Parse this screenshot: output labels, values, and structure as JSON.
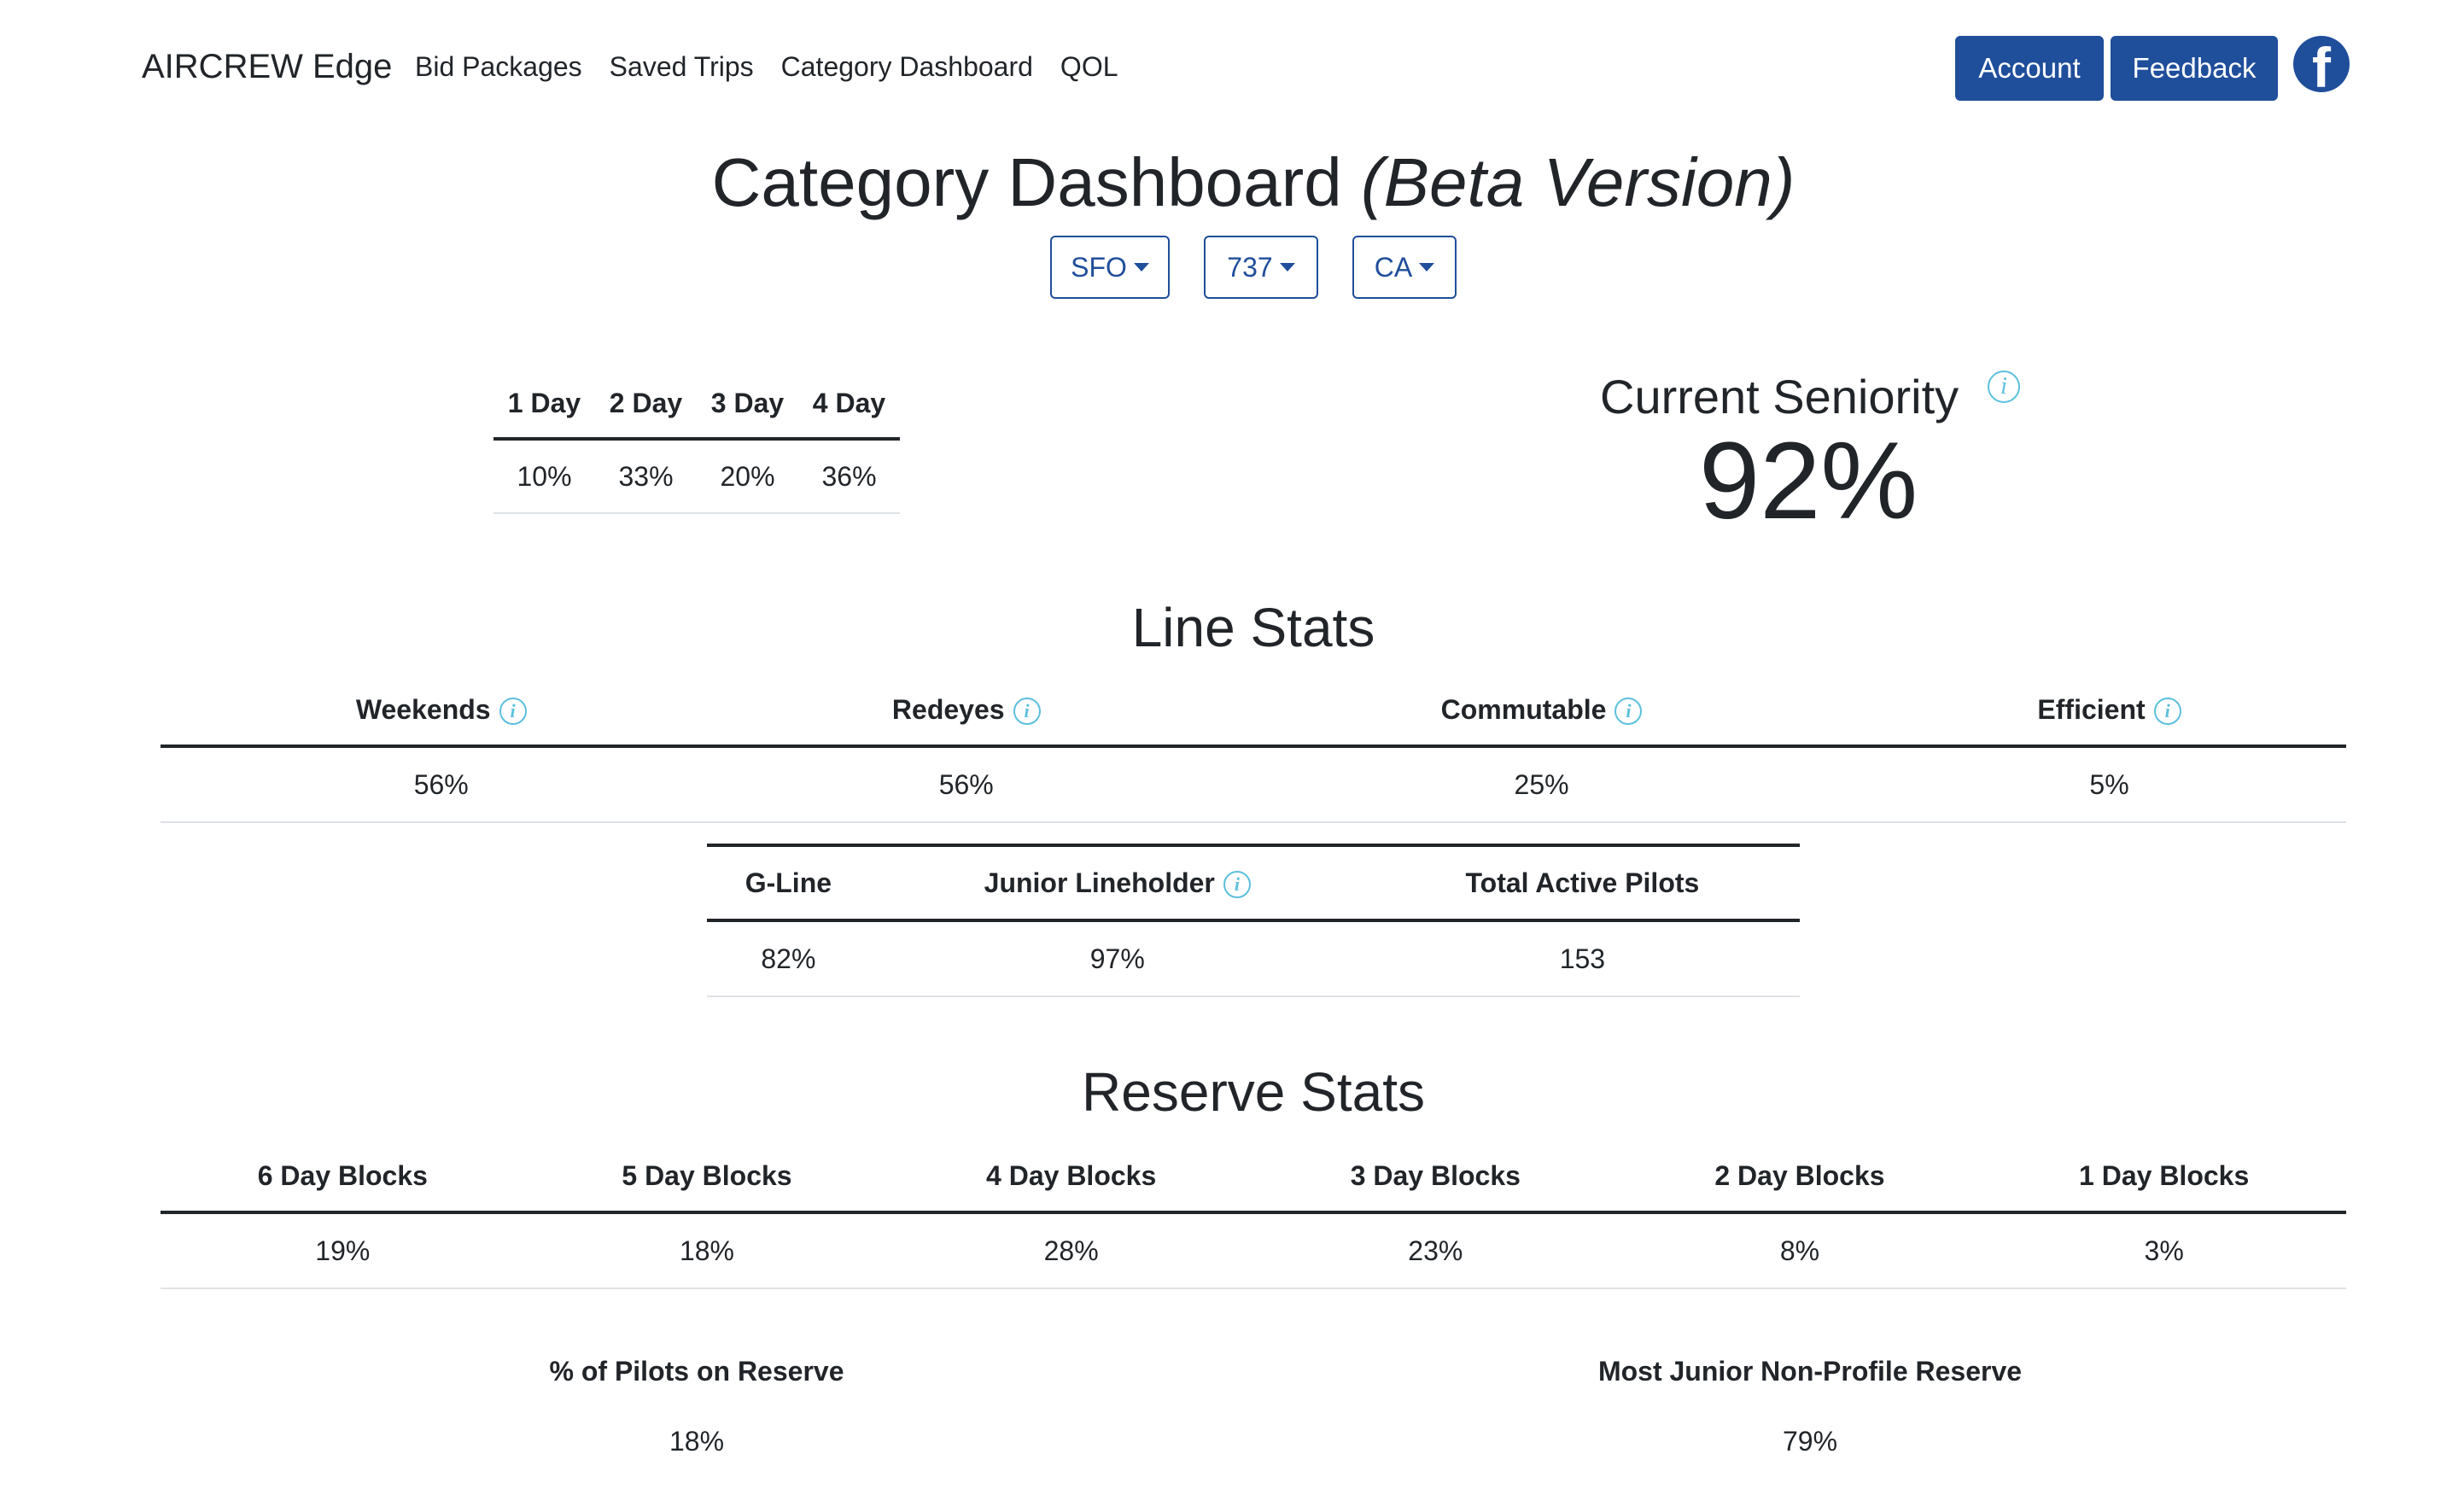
{
  "navbar": {
    "brand": "AIRCREW Edge",
    "links": [
      "Bid Packages",
      "Saved Trips",
      "Category Dashboard",
      "QOL"
    ],
    "account_label": "Account",
    "feedback_label": "Feedback",
    "social_icon": "facebook-icon"
  },
  "page": {
    "title": "Category Dashboard",
    "title_suffix": "(Beta Version)"
  },
  "filters": {
    "base": "SFO",
    "fleet": "737",
    "seat": "CA"
  },
  "trip_lengths": {
    "headers": [
      "1 Day",
      "2 Day",
      "3 Day",
      "4 Day"
    ],
    "values": [
      "10%",
      "33%",
      "20%",
      "36%"
    ]
  },
  "seniority": {
    "label": "Current Seniority",
    "value": "92%"
  },
  "line_stats": {
    "title": "Line Stats",
    "headers": [
      "Weekends",
      "Redeyes",
      "Commutable",
      "Efficient"
    ],
    "values": [
      "56%",
      "56%",
      "25%",
      "5%"
    ],
    "extra_headers": [
      "G-Line",
      "Junior Lineholder",
      "Total Active Pilots"
    ],
    "extra_values": [
      "82%",
      "97%",
      "153"
    ]
  },
  "reserve_stats": {
    "title": "Reserve Stats",
    "headers": [
      "6 Day Blocks",
      "5 Day Blocks",
      "4 Day Blocks",
      "3 Day Blocks",
      "2 Day Blocks",
      "1 Day Blocks"
    ],
    "values": [
      "19%",
      "18%",
      "28%",
      "23%",
      "8%",
      "3%"
    ],
    "pilots_on_reserve_label": "% of Pilots on Reserve",
    "pilots_on_reserve_value": "18%",
    "junior_reserve_label": "Most Junior Non-Profile Reserve",
    "junior_reserve_value": "79%"
  },
  "colors": {
    "primary": "#1f4e9b",
    "info": "#5bc0de",
    "text": "#212529"
  }
}
